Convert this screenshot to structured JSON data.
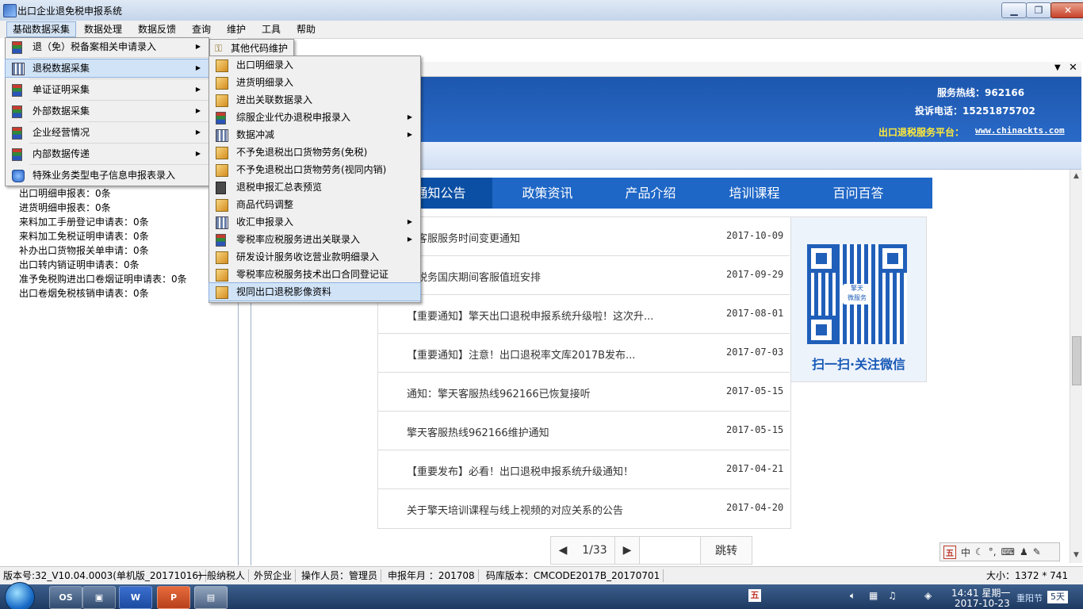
{
  "window": {
    "title": "出口企业退免税申报系统"
  },
  "menubar": [
    "基础数据采集",
    "数据处理",
    "数据反馈",
    "查询",
    "维护",
    "工具",
    "帮助"
  ],
  "menu_level1": [
    {
      "label": "退（免）税备案相关申请录入",
      "icon": "ledger-icon",
      "submenu": true
    },
    {
      "label": "退税数据采集",
      "icon": "grid-icon",
      "submenu": true
    },
    {
      "label": "单证证明采集",
      "icon": "ledger-icon",
      "submenu": true
    },
    {
      "label": "外部数据采集",
      "icon": "ledger-icon",
      "submenu": true
    },
    {
      "label": "企业经营情况",
      "icon": "ledger-icon",
      "submenu": true
    },
    {
      "label": "内部数据传递",
      "icon": "ledger-icon",
      "submenu": true
    },
    {
      "label": "特殊业务类型电子信息申报表录入",
      "icon": "database-icon",
      "submenu": false
    }
  ],
  "menu_side": {
    "label": "其他代码维护",
    "icon": "key-icon"
  },
  "menu_level2": [
    {
      "label": "出口明细录入",
      "icon": "pencil-icon",
      "submenu": false
    },
    {
      "label": "进货明细录入",
      "icon": "pencil-icon",
      "submenu": false
    },
    {
      "label": "进出关联数据录入",
      "icon": "pencil-icon",
      "submenu": false
    },
    {
      "label": "综服企业代办退税申报录入",
      "icon": "ledger-icon",
      "submenu": true
    },
    {
      "label": "数据冲减",
      "icon": "grid-icon",
      "submenu": true
    },
    {
      "label": "不予免退税出口货物劳务(免税)",
      "icon": "pencil-icon",
      "submenu": false
    },
    {
      "label": "不予免退税出口货物劳务(视同内销)",
      "icon": "pencil-icon",
      "submenu": false
    },
    {
      "label": "退税申报汇总表预览",
      "icon": "document-icon",
      "submenu": false
    },
    {
      "label": "商品代码调整",
      "icon": "pencil-icon",
      "submenu": false
    },
    {
      "label": "收汇申报录入",
      "icon": "grid-icon",
      "submenu": true
    },
    {
      "label": "零税率应税服务进出关联录入",
      "icon": "ledger-icon",
      "submenu": true
    },
    {
      "label": "研发设计服务收讫营业款明细录入",
      "icon": "pencil-icon",
      "submenu": false
    },
    {
      "label": "零税率应税服务技术出口合同登记证",
      "icon": "pencil-icon",
      "submenu": false
    },
    {
      "label": "视同出口退税影像资料",
      "icon": "pencil-icon",
      "submenu": false
    }
  ],
  "left_stats": [
    "出口明细申报表：0条",
    "进货明细申报表：0条",
    "来料加工手册登记申请表：0条",
    "来料加工免税证明申请表：0条",
    "补办出口货物报关单申请：0条",
    "出口转内销证明申请表：0条",
    "准予免税购进出口卷烟证明申请表：0条",
    "出口卷烟免税核销申请表：0条"
  ],
  "banner": {
    "hotline": "服务热线：962166",
    "complaint": "投诉电话：15251875702",
    "platform_label": "出口退税服务平台：",
    "platform_url": "www.chinackts.com"
  },
  "news_tabs": [
    "通知公告",
    "政策资讯",
    "产品介绍",
    "培训课程",
    "百问百答"
  ],
  "news": [
    {
      "title": "天客服服务时间变更通知",
      "date": "2017-10-09"
    },
    {
      "title": "天税务国庆期间客服值班安排",
      "date": "2017-09-29"
    },
    {
      "title": "【重要通知】擎天出口退税申报系统升级啦！这次升...",
      "date": "2017-08-01"
    },
    {
      "title": "【重要通知】注意！出口退税率文库2017B发布...",
      "date": "2017-07-03"
    },
    {
      "title": "通知：擎天客服热线962166已恢复接听",
      "date": "2017-05-15"
    },
    {
      "title": "擎天客服热线962166维护通知",
      "date": "2017-05-15"
    },
    {
      "title": "【重要发布】必看！出口退税申报系统升级通知！",
      "date": "2017-04-21"
    },
    {
      "title": "关于擎天培训课程与线上视频的对应关系的公告",
      "date": "2017-04-20"
    }
  ],
  "qr": {
    "center_line1": "擎天",
    "center_line2": "微服务",
    "caption": "扫一扫·关注微信"
  },
  "pagination": {
    "page": "1/33",
    "jump": "跳转",
    "input_value": ""
  },
  "ime": {
    "label": "中"
  },
  "statusbar": [
    "版本号:32_V10.04.0003(单机版_20171016)",
    "一般纳税人",
    "外贸企业",
    "操作人员：管理员",
    "申报年月 ：201708",
    "码库版本：CMCODE2017B_20170701",
    "大小：1372 * 741"
  ],
  "taskbar": {
    "apps": [
      "OS",
      "",
      "W",
      "P",
      ""
    ],
    "time": "14:41 星期一",
    "date": "2017-10-23",
    "festival": "重阳节",
    "badge": "5天"
  },
  "colors": {
    "banner_blue": "#1d57ae",
    "nav_blue": "#1f67c6",
    "qr_blue": "#1658b6"
  }
}
